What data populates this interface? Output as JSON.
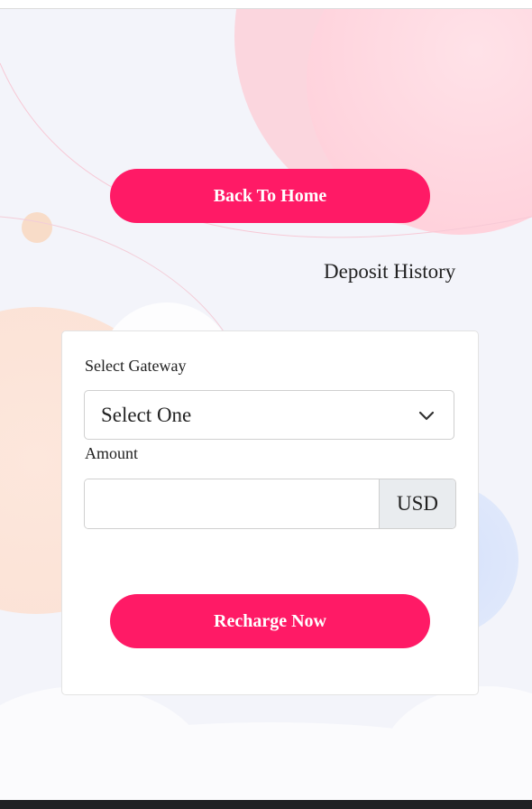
{
  "header": {
    "back_label": "Back To Home",
    "history_label": "Deposit History"
  },
  "form": {
    "gateway_label": "Select Gateway",
    "gateway_selected": "Select One",
    "amount_label": "Amount",
    "amount_value": "",
    "amount_placeholder": "",
    "currency": "USD",
    "submit_label": "Recharge Now"
  },
  "theme": {
    "accent": "#ff1a66",
    "page_bg": "#f3f4fa",
    "card_bg": "#ffffff",
    "addon_bg": "#e9ecef"
  }
}
